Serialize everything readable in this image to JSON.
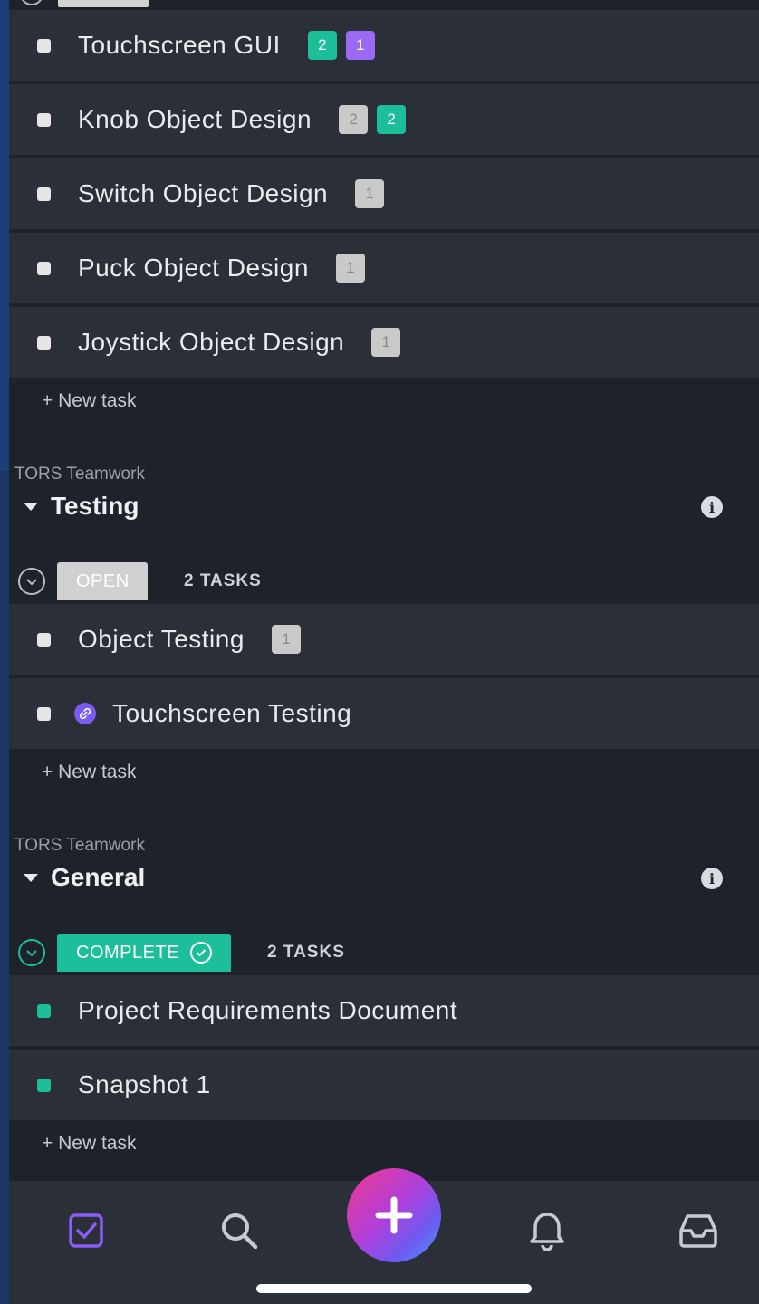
{
  "sections": [
    {
      "tasks": [
        {
          "name": "Touchscreen GUI",
          "badges": [
            {
              "text": "2",
              "color": "green"
            },
            {
              "text": "1",
              "color": "purple"
            }
          ]
        },
        {
          "name": "Knob Object Design",
          "badges": [
            {
              "text": "2",
              "color": "gray"
            },
            {
              "text": "2",
              "color": "green"
            }
          ]
        },
        {
          "name": "Switch Object Design",
          "badges": [
            {
              "text": "1",
              "color": "gray"
            }
          ]
        },
        {
          "name": "Puck Object Design",
          "badges": [
            {
              "text": "1",
              "color": "gray"
            }
          ]
        },
        {
          "name": "Joystick Object Design",
          "badges": [
            {
              "text": "1",
              "color": "gray"
            }
          ]
        }
      ],
      "new_task": "+ New task"
    },
    {
      "space": "TORS Teamwork",
      "title": "Testing",
      "status": "OPEN",
      "count": "2 TASKS",
      "tasks": [
        {
          "name": "Object Testing",
          "badges": [
            {
              "text": "1",
              "color": "gray"
            }
          ]
        },
        {
          "name": "Touchscreen Testing",
          "icon": "link-icon"
        }
      ],
      "new_task": "+ New task"
    },
    {
      "space": "TORS Teamwork",
      "title": "General",
      "status": "COMPLETE",
      "count": "2 TASKS",
      "tasks": [
        {
          "name": "Project Requirements Document"
        },
        {
          "name": "Snapshot 1"
        }
      ],
      "new_task": "+ New task"
    }
  ],
  "info_glyph": "i",
  "colors": {
    "background": "#1e232b",
    "row": "#2a2f38",
    "complete": "#1dbf9a",
    "purple": "#9b6af5",
    "accent": "#7a5cf0"
  },
  "nav": [
    "tasks-icon",
    "search-icon",
    "add-icon",
    "bell-icon",
    "inbox-icon"
  ]
}
